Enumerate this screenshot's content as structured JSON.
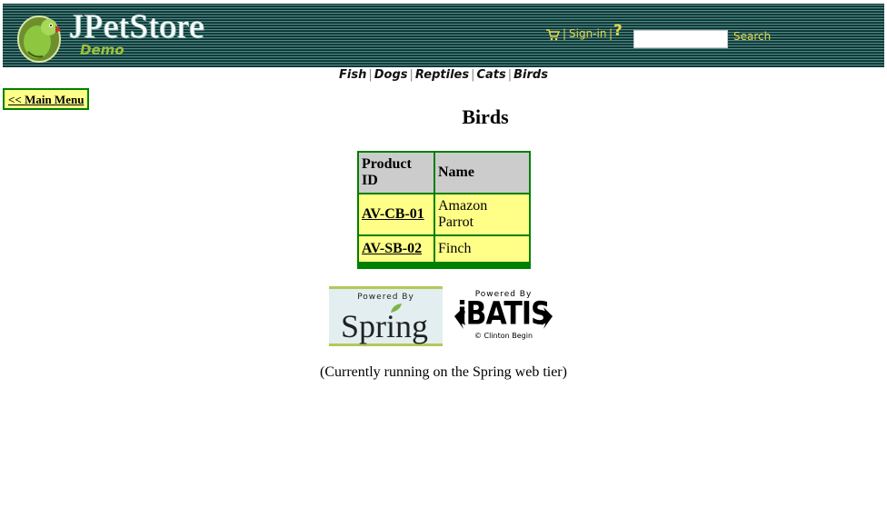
{
  "header": {
    "title": "JPetStore",
    "subtitle": "Demo",
    "signin_label": "Sign-in",
    "separator": "|",
    "help_glyph": "?",
    "search_placeholder": "",
    "search_value": "",
    "search_label": "Search",
    "icons": [
      "parrot-logo-icon",
      "cart-icon",
      "help-icon"
    ]
  },
  "nav": {
    "categories": [
      {
        "label": "Fish"
      },
      {
        "label": "Dogs"
      },
      {
        "label": "Reptiles"
      },
      {
        "label": "Cats"
      },
      {
        "label": "Birds"
      }
    ],
    "separator": "|"
  },
  "back_link": "<< Main Menu",
  "page_title": "Birds",
  "table": {
    "columns": [
      "Product ID",
      "Name"
    ],
    "rows": [
      {
        "id": "AV-CB-01",
        "name": "Amazon Parrot"
      },
      {
        "id": "AV-SB-02",
        "name": "Finch"
      }
    ]
  },
  "logos": {
    "spring": {
      "powered_by": "Powered By",
      "name": "Spring"
    },
    "ibatis": {
      "powered_by": "Powered By",
      "name": "iBATIS",
      "copyright": "© Clinton Begin"
    }
  },
  "footer_note": "(Currently running on the Spring web tier)",
  "colors": {
    "banner": "#103a3a",
    "header_link": "#e8d64a",
    "table_border": "#008000",
    "cell_bg": "#ffff88",
    "header_cell_bg": "#cccccc"
  }
}
